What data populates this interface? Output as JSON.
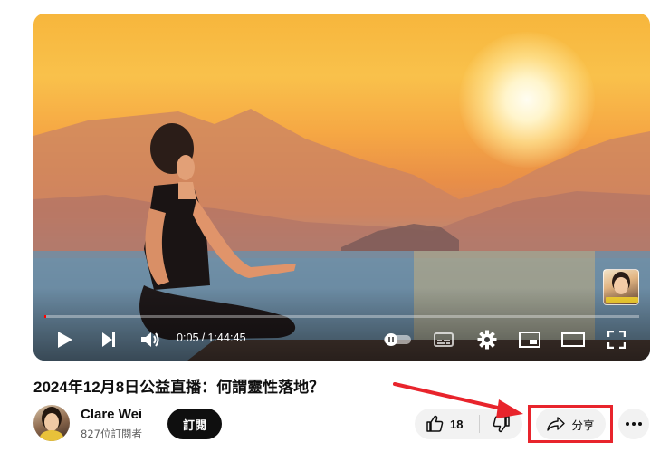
{
  "player": {
    "current_time": "0:05",
    "separator": "/",
    "duration": "1:44:45",
    "progress_fraction": 0.0008,
    "controls": [
      "play-icon",
      "next-icon",
      "volume-icon",
      "autoplay-toggle-icon",
      "subtitles-icon",
      "settings-gear-icon",
      "miniplayer-icon",
      "theater-mode-icon",
      "fullscreen-icon"
    ]
  },
  "video": {
    "title": "2024年12月8日公益直播：何謂靈性落地？"
  },
  "channel": {
    "name": "Clare Wei",
    "subscribers": "827位訂閱者",
    "subscribe_label": "訂閱"
  },
  "actions": {
    "like_count": "18",
    "share_label": "分享"
  },
  "annotation": {
    "highlight_color": "#e8242c"
  },
  "colors": {
    "progress": "#ff0000",
    "button_bg": "#f2f2f2",
    "subscribe_bg": "#0f0f0f"
  }
}
